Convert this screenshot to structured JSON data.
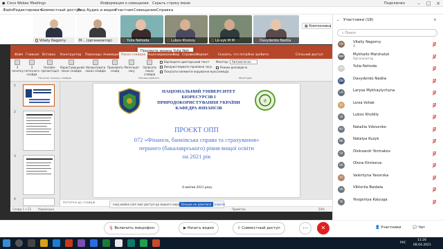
{
  "titlebar": {
    "app": "Cisco Webex Meetings",
    "tab1": "Информация о совещании",
    "tab2": "Скрыть строку меню",
    "user": "Подключен"
  },
  "menu": {
    "items": [
      "Файл",
      "Редактировать",
      "Совместный доступ",
      "Вид",
      "Аудио и видео",
      "Участник",
      "Совещание",
      "Справка"
    ]
  },
  "strip": {
    "tiles": [
      {
        "name": "Vitaliy Nagorny"
      },
      {
        "name": "M...",
        "role": "(организатор)"
      },
      {
        "name": "Yulia Nehoda"
      },
      {
        "name": "Lubov Kholoiy"
      },
      {
        "name": "Lk-vyk M M"
      },
      {
        "name": "Davydenko Nadiia"
      }
    ],
    "layout_label": "Компоновка"
  },
  "ppt": {
    "file_tab": "Файл",
    "tabs": [
      "Файл",
      "Главная",
      "Вставка",
      "Конструктор",
      "Переходы",
      "Анимация",
      "Показ слайдов",
      "Рецензирование",
      "Вид",
      "Справка",
      "Формат",
      "Сказать, что потрібно зробити",
      "Спільний доступ"
    ],
    "ribbon": {
      "buttons": [
        "З початку",
        "З поточного слайда",
        "Онлайн-презентація",
        "Користувацький показ слайдів",
        "Налаштувати показ слайдів",
        "Приховати слайд",
        "Репетиція часу",
        "Записати показ слайдів"
      ],
      "checks": [
        "Відтворити дикторський текст",
        "Використовувати проміжки часу",
        "Показати елементи керування мультимедіа"
      ],
      "monitor_label": "Монітор:",
      "monitor_value": "Автоматично",
      "presenter_view": "Режим доповідача",
      "groups": [
        "Початок показу слайдів",
        "Налаштування",
        "Монітори"
      ]
    },
    "popup": "Просмотр экрана Yulia Neh...",
    "thumb_numbers": [
      "1",
      "2",
      "3",
      "4"
    ],
    "slide": {
      "uni1": "НАЦІОНАЛЬНИЙ УНІВЕРСИТЕТ",
      "uni2": "БІОРЕСУРСІВ І",
      "uni3": "ПРИРОДОКОРИСТУВАННЯ УКРАЇНИ",
      "uni4": "КАФЕДРА ФІНАНСІВ",
      "title": "ПРОЄКТ ОПП",
      "line1": "072 «Фінанси, банківська справа та страхування»",
      "line2": "першого (бакалаврського) рівня вищої освіти",
      "line3": "на 2021 рік",
      "date": "8 квітня 2021 року"
    },
    "notes": "Нотатки до слайдів",
    "status": {
      "slide": "Слайд 1 з 23",
      "lang": "Українська",
      "notes": "Примітки",
      "zoom": "54%"
    },
    "notif": {
      "text": "nuip.webex.com має доступ до вашого екрана.",
      "btn": "Більше не ділитися",
      "hide": "Сховати"
    }
  },
  "panel": {
    "title": "Участники (18)",
    "search_placeholder": "Поиск",
    "participants": [
      {
        "initials": "VN",
        "name": "Vitaliy Nagorny",
        "role": "Я",
        "color": "#8a6f5a"
      },
      {
        "initials": "MM",
        "name": "Mykhailo Marshaluk",
        "role": "Организатор",
        "color": "#6b6b6b"
      },
      {
        "initials": "YN",
        "name": "Yulia Nehoda",
        "role": "",
        "color": "#d0d0d0"
      },
      {
        "initials": "DN",
        "name": "Davydenko Nadiia",
        "role": "",
        "color": "#3d5a80"
      },
      {
        "initials": "LM",
        "name": "Larysa Mykhaylychyna",
        "role": "",
        "color": "#5e6b73"
      },
      {
        "initials": "LV",
        "name": "Lesia Voliak",
        "role": "",
        "color": "#d1a36b"
      },
      {
        "initials": "LK",
        "name": "Lubov Kholdiy",
        "role": "",
        "color": "#6c757d"
      },
      {
        "initials": "NV",
        "name": "Nataliia Vdovenko",
        "role": "",
        "color": "#6c757d"
      },
      {
        "initials": "NK",
        "name": "Natalya Kuzyk",
        "role": "",
        "color": "#6c757d"
      },
      {
        "initials": "OY",
        "name": "Oleksandr Yermakov",
        "role": "",
        "color": "#6c757d"
      },
      {
        "initials": "OK",
        "name": "Olena Kirelseva",
        "role": "",
        "color": "#6c757d"
      },
      {
        "initials": "VY",
        "name": "Valentyna Yavorska",
        "role": "",
        "color": "#b0876a"
      },
      {
        "initials": "VB",
        "name": "Viktoriia Baidala",
        "role": "",
        "color": "#6c757d"
      },
      {
        "initials": "YK",
        "name": "Yevgeniya Kalyuga",
        "role": "",
        "color": "#6c757d"
      }
    ]
  },
  "controls": {
    "mic": "Включить микрофон",
    "video": "Начать видео",
    "share": "Совместный доступ",
    "participants": "Участники",
    "chat": "Чат"
  },
  "taskbar": {
    "lang": "РУС",
    "time": "11:26",
    "date": "08.04.2021"
  },
  "colors": {
    "ppt_red": "#b7472a",
    "webex_green": "#2aa14a",
    "end_red": "#e02020"
  }
}
